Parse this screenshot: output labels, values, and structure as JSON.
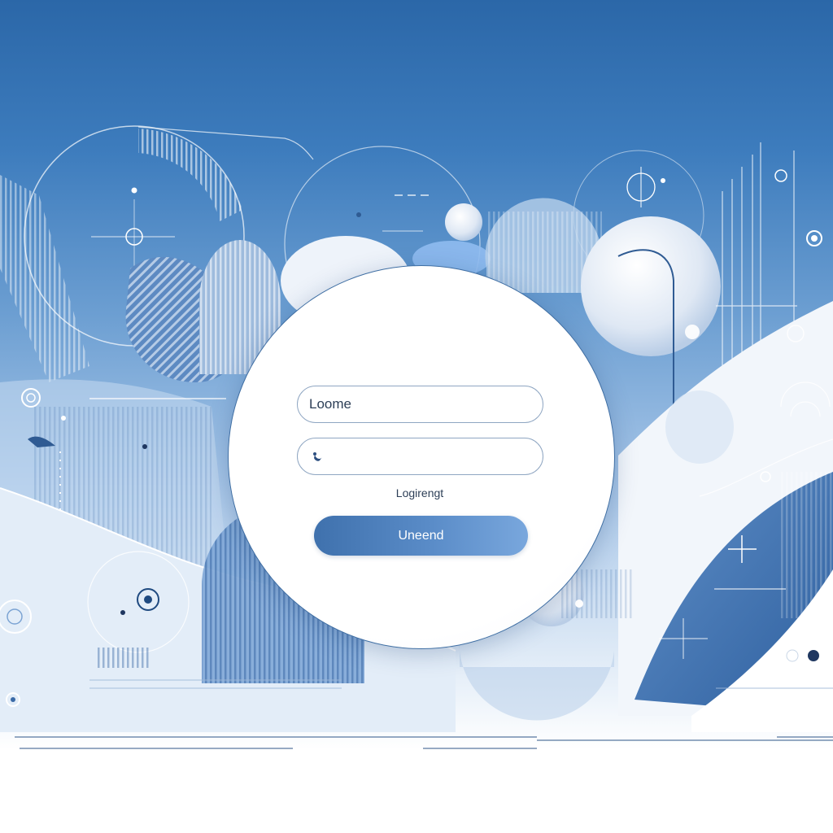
{
  "theme": {
    "accent": "#3f71ad",
    "background_top": "#2b67a8",
    "background_bottom": "#ffffff",
    "text": "#2d3f57"
  },
  "login_form": {
    "username_field": {
      "value": "",
      "placeholder": "Loome"
    },
    "password_field": {
      "value": "",
      "placeholder": "",
      "icon": "key-icon"
    },
    "helper_text": "Logirengt",
    "submit_label": "Uneend"
  }
}
